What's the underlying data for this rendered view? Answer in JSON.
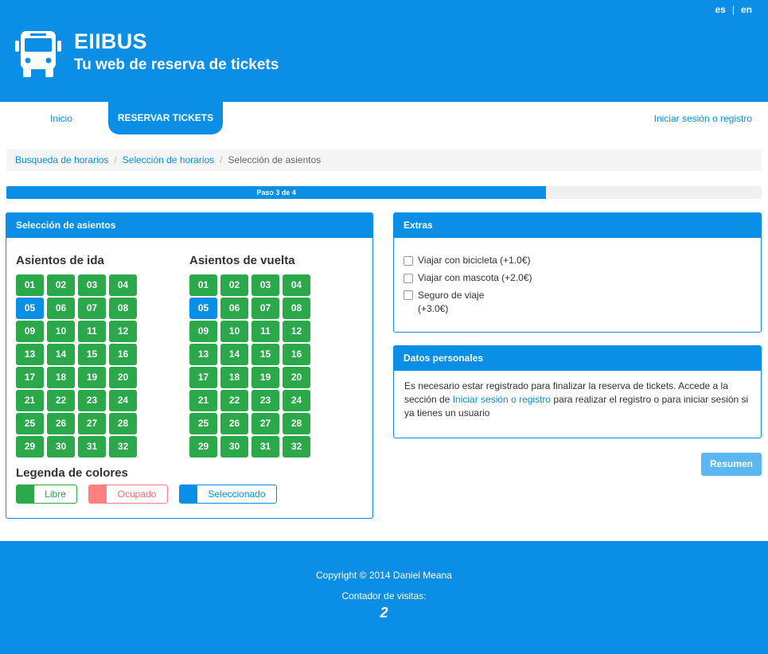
{
  "header": {
    "brand": "EIIBUS",
    "tagline": "Tu web de reserva de tickets",
    "logo_icon": "bus-icon",
    "languages": [
      "es",
      "en"
    ],
    "lang_separator": "|"
  },
  "nav": {
    "inicio": "Inicio",
    "reservar": "RESERVAR TICKETS",
    "login": "Iniciar sesión o registro"
  },
  "breadcrumb": {
    "items": [
      "Busqueda de horarios",
      "Selección de horarios",
      "Selección de asientos"
    ],
    "separator": "/"
  },
  "progress": {
    "label": "Paso 3 de 4",
    "fraction": 0.75
  },
  "seats_panel": {
    "heading": "Selección de asientos",
    "ida_title": "Asientos de ida",
    "vuelta_title": "Asientos de vuelta",
    "seats": [
      "01",
      "02",
      "03",
      "04",
      "05",
      "06",
      "07",
      "08",
      "09",
      "10",
      "11",
      "12",
      "13",
      "14",
      "15",
      "16",
      "17",
      "18",
      "19",
      "20",
      "21",
      "22",
      "23",
      "24",
      "25",
      "26",
      "27",
      "28",
      "29",
      "30",
      "31",
      "32"
    ],
    "ida_selected": "05",
    "vuelta_selected": "05",
    "legend_title": "Legenda de colores",
    "legend": {
      "libre": "Libre",
      "ocupado": "Ocupado",
      "seleccionado": "Seleccionado"
    }
  },
  "extras_panel": {
    "heading": "Extras",
    "items": [
      {
        "line1": "Viajar con bicicleta (+1.0€)",
        "line2": ""
      },
      {
        "line1": "Viajar con mascota (+2.0€)",
        "line2": ""
      },
      {
        "line1": "Seguro de viaje",
        "line2": "(+3.0€)"
      }
    ]
  },
  "personal_panel": {
    "heading": "Datos personales",
    "text_before": "Es necesario estar registrado para finalizar la reserva de tickets. Accede a la sección de ",
    "link": "Iniciar sesión o registro",
    "text_after": " para realizar el registro o para iniciar sesión si ya tienes un usuario"
  },
  "resumen_button": "Resumen",
  "footer": {
    "copyright": "Copyright © 2014 Daniel Meana",
    "visits_label": "Contador de visitas:",
    "visits_count": "2"
  },
  "colors": {
    "primary": "#0a8ee6",
    "free": "#2ba84a",
    "occupied": "#ff8082",
    "selected": "#0a8ee6"
  }
}
